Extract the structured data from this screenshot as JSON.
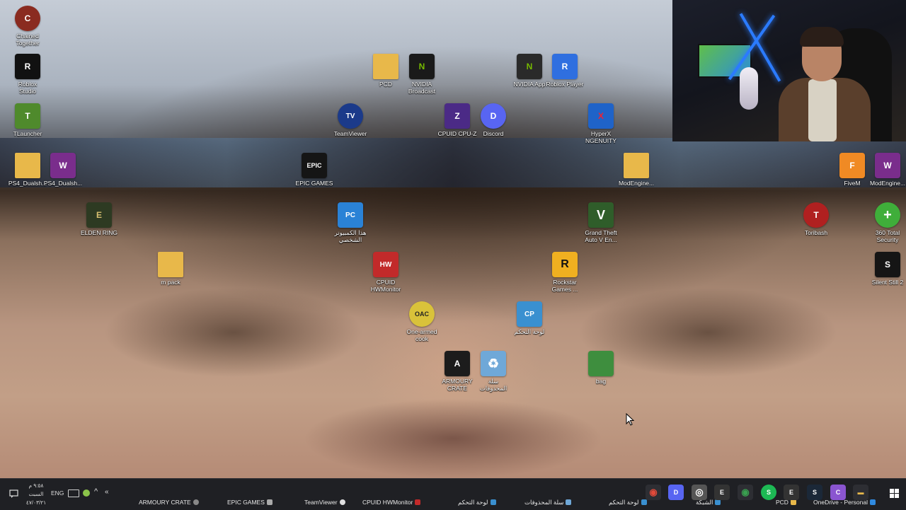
{
  "desktop": {
    "icons": [
      {
        "label": "Chained\nTogether",
        "art": "C",
        "color": "#8a2b20"
      },
      {
        "label": "Roblox\nStudio",
        "art": "R",
        "color": "#111111"
      },
      {
        "label": "TLauncher",
        "art": "T",
        "color": "#4f8a2c"
      },
      {
        "label": "PS4_Dualsh...",
        "art": "",
        "color": "#e8b84a"
      },
      {
        "label": "PS4_Dualsh...",
        "art": "W",
        "color": "#7a2d8c"
      },
      {
        "label": "ELDEN RING",
        "art": "E",
        "color": "#2d3a22"
      },
      {
        "label": "m pack",
        "art": "",
        "color": "#e8b84a"
      },
      {
        "label": "PCD",
        "art": "",
        "color": "#e8b84a"
      },
      {
        "label": "NVIDIA\nBroadcast",
        "art": "N",
        "color": "#1a1a1a"
      },
      {
        "label": "NVIDIA App",
        "art": "N",
        "color": "#2a2a2a"
      },
      {
        "label": "Roblox Player",
        "art": "R",
        "color": "#2f6fe0"
      },
      {
        "label": "TeamViewer",
        "art": "TV",
        "color": "#1b3a8a"
      },
      {
        "label": "CPUID CPU-Z",
        "art": "Z",
        "color": "#4b2a86"
      },
      {
        "label": "Discord",
        "art": "D",
        "color": "#5865f2"
      },
      {
        "label": "HyperX\nNGENUITY",
        "art": "X",
        "color": "#1f63c8"
      },
      {
        "label": "EPIC GAMES",
        "art": "EPIC",
        "color": "#151515"
      },
      {
        "label": "ModEngine...",
        "art": "",
        "color": "#e8b84a"
      },
      {
        "label": "FiveM",
        "art": "F",
        "color": "#f08a24"
      },
      {
        "label": "ModEngine...",
        "art": "W",
        "color": "#7a2d8c"
      },
      {
        "label": "هذا الكمبيوتر\nالشخصي",
        "art": "PC",
        "color": "#2a82d6"
      },
      {
        "label": "Grand Theft\nAuto V En...",
        "art": "V",
        "color": "#2f5d2a"
      },
      {
        "label": "Toribash",
        "art": "T",
        "color": "#b02020"
      },
      {
        "label": "360 Total\nSecurity",
        "art": "+",
        "color": "#3fae3a"
      },
      {
        "label": "CPUID\nHWMonitor",
        "art": "HW",
        "color": "#c22a2a"
      },
      {
        "label": "Rockstar\nGames ...",
        "art": "R",
        "color": "#f0b020"
      },
      {
        "label": "Silent Still 2",
        "art": "S",
        "color": "#151515"
      },
      {
        "label": "One-armed\ncook",
        "art": "OAC",
        "color": "#d9c23a"
      },
      {
        "label": "لوحة التحكم",
        "art": "CP",
        "color": "#3a90d0"
      },
      {
        "label": "ARMOURY\nCRATE",
        "art": "A",
        "color": "#1c1c1c"
      },
      {
        "label": "سلة\nالمحذوفات",
        "art": "♻",
        "color": "#6fa8d8"
      },
      {
        "label": "bag",
        "art": "",
        "color": "#3e8e3e"
      }
    ]
  },
  "taskbar": {
    "time": "٩:٥٨ م",
    "day": "السبت",
    "date": "٤٧/٠٣/٢١",
    "language": "ENG",
    "apps": [
      {
        "label": "ARMOURY CRATE",
        "color": "#888888"
      },
      {
        "label": "EPIC GAMES",
        "color": "#aaaaaa"
      },
      {
        "label": "TeamViewer",
        "color": "#e0e0e0"
      },
      {
        "label": "CPUID HWMonitor",
        "color": "#c22a2a"
      },
      {
        "label": "لوحة التحكم",
        "color": "#3a90d0"
      },
      {
        "label": "سلة المحذوفات",
        "color": "#6fa8d8"
      },
      {
        "label": "لوحة التحكم",
        "color": "#3a90d0"
      },
      {
        "label": "الشبكة",
        "color": "#3a90d0"
      },
      {
        "label": "PCD",
        "color": "#e8b84a"
      },
      {
        "label": "OneDrive - Personal",
        "color": "#2f8ae0"
      }
    ],
    "pinned": [
      {
        "glyph": "◉",
        "color": "#e24a3a"
      },
      {
        "glyph": "D",
        "color": "#5865f2"
      },
      {
        "glyph": "◎",
        "color": "#555555"
      },
      {
        "glyph": "E",
        "color": "#333333"
      },
      {
        "glyph": "◉",
        "color": "#3aa050"
      },
      {
        "glyph": "S",
        "color": "#1db954"
      },
      {
        "glyph": "E",
        "color": "#333333"
      },
      {
        "glyph": "S",
        "color": "#1b2838"
      },
      {
        "glyph": "C",
        "color": "#8a55d0"
      },
      {
        "glyph": "▬",
        "color": "#e8b84a"
      }
    ]
  }
}
